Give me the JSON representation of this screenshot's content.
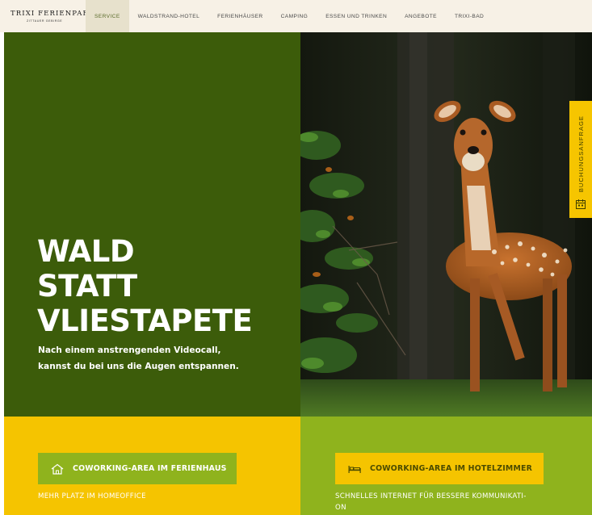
{
  "logo": {
    "name": "TRIXI FERIENPARK",
    "subtitle": "ZITTAUER GEBIRGE"
  },
  "nav": {
    "items": [
      {
        "label": "SERVICE"
      },
      {
        "label": "WALDSTRAND-HOTEL"
      },
      {
        "label": "FERIENHÄUSER"
      },
      {
        "label": "CAMPING"
      },
      {
        "label": "ESSEN UND TRINKEN"
      },
      {
        "label": "ANGEBOTE"
      },
      {
        "label": "TRIXI-BAD"
      }
    ],
    "active_index": 0
  },
  "hero": {
    "headline_lines": [
      "WALD",
      "STATT",
      "VLIESTAPETE"
    ],
    "subline_lines": [
      "Nach einem anstrengenden Videocall,",
      "kannst du bei uns die Augen entspannen."
    ],
    "image_subject": "deer-fawn-in-forest"
  },
  "side_tab": {
    "label": "BUCHUNGSANFRAGE",
    "icon": "calendar-icon"
  },
  "panels": {
    "left": {
      "button_label": "COWORKING-AREA IM FERIENHAUS",
      "button_icon": "house-icon",
      "caption": "MEHR PLATZ IM HOMEOFFICE"
    },
    "right": {
      "button_label": "COWORKING-AREA IM HOTELZIMMER",
      "button_icon": "bed-icon",
      "caption_lines": [
        "SCHNELLES INTERNET FÜR BESSERE KOMMUNIKATI-",
        "ON"
      ]
    }
  },
  "colors": {
    "nav_bg": "#f7f1e6",
    "hero_green": "#3c5c0a",
    "accent_yellow": "#f5c400",
    "accent_green": "#8fb31d"
  }
}
